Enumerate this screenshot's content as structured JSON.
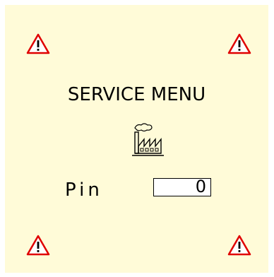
{
  "screen": {
    "title": "SERVICE MENU",
    "icons": {
      "warning": "warning-triangle-icon",
      "factory": "factory-icon"
    },
    "pin": {
      "label": "Pin",
      "value": "0"
    }
  },
  "colors": {
    "background": "#fffbd8",
    "warning": "#e00000"
  }
}
